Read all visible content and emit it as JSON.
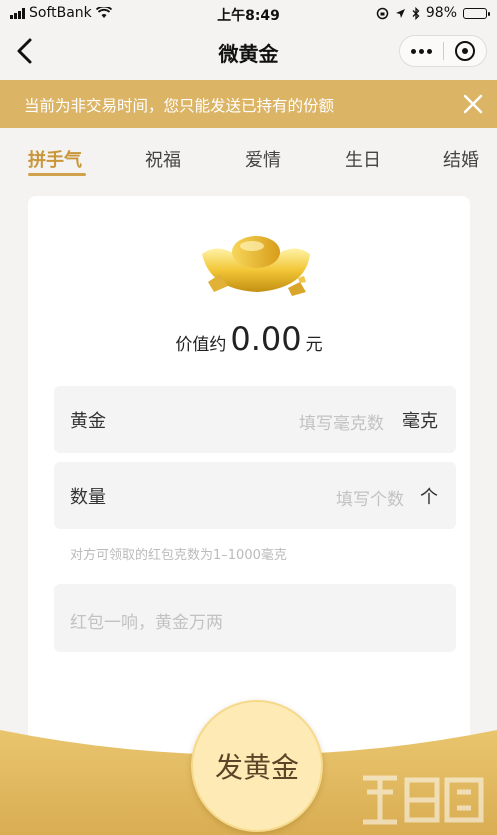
{
  "status_bar": {
    "carrier": "SoftBank",
    "time": "上午8:49",
    "battery": "98%",
    "battery_level": 0.98
  },
  "nav": {
    "title": "微黄金"
  },
  "notice": {
    "text": "当前为非交易时间，您只能发送已持有的份额"
  },
  "tabs": [
    "拼手气",
    "祝福",
    "爱情",
    "生日",
    "结婚"
  ],
  "active_tab": "拼手气",
  "card": {
    "value_prefix": "价值约",
    "value": "0.00",
    "value_unit": "元",
    "gold_field": {
      "label": "黄金",
      "placeholder": "填写毫克数",
      "unit": "毫克"
    },
    "count_field": {
      "label": "数量",
      "placeholder": "填写个数",
      "unit": "个"
    },
    "hint": "对方可领取的红包克数为1–1000毫克",
    "message_placeholder": "红包一响，黄金万两"
  },
  "send_button": "发黄金",
  "colors": {
    "accent": "#dcb465",
    "tab_active": "#c9963a",
    "button_fill": "#fdeab4"
  }
}
